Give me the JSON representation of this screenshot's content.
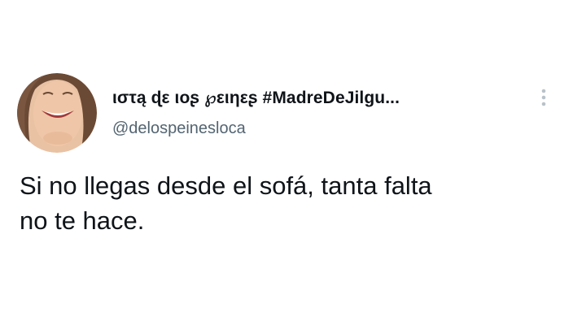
{
  "tweet": {
    "author": {
      "display_name": "ιστą ɖε ιοʂ ℘ειηεʂ #MadreDeJilgu...",
      "handle": "@delospeinesloca",
      "avatar_icon": "profile-photo"
    },
    "menu_icon": "more-options-icon",
    "text": "Si no llegas desde el sofá, tanta falta\nno te hace."
  },
  "colors": {
    "background": "#ffffff",
    "text_primary": "#0f1419",
    "text_secondary": "#536471",
    "icon_muted": "#b9c2c9"
  }
}
